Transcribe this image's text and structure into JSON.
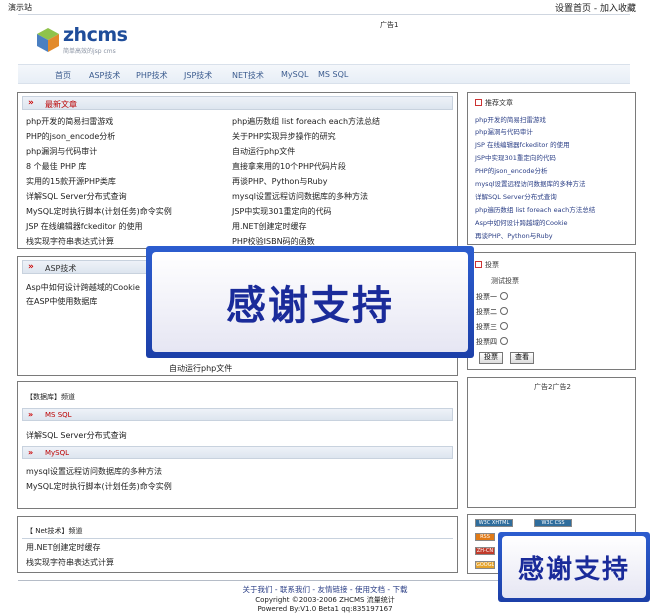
{
  "topbar": {
    "site_name": "演示站",
    "set_home": "设置首页",
    "sep": " - ",
    "add_fav": "加入收藏"
  },
  "logo": {
    "name": "zhcms",
    "slogan": "简单高效的jsp cms"
  },
  "ad1": "广告1",
  "nav": [
    "首页",
    "ASP技术",
    "PHP技术",
    "JSP技术",
    "NET技术",
    "MySQL",
    "MS SQL"
  ],
  "latest": {
    "title": "最新文章",
    "left": [
      "php开发的简易扫雷游戏",
      "PHP的json_encode分析",
      "php漏洞与代码审计",
      "8 个最佳 PHP 库",
      "实用的15款开源PHP类库",
      "详解SQL Server分布式查询",
      "MySQL定时执行脚本(计划任务)命令实例",
      "JSP 在线编辑器fckeditor 的使用",
      "栈实现字符串表达式计算"
    ],
    "right": [
      "php遍历数组 list foreach each方法总结",
      "关于PHP实现异步操作的研究",
      "自动运行php文件",
      "直接拿来用的10个PHP代码片段",
      "再谈PHP、Python与Ruby",
      "mysql设置远程访问数据库的多种方法",
      "JSP中实现301重定向的代码",
      "用.NET创建定时缓存",
      "PHP校验ISBN码的函数"
    ]
  },
  "asp": {
    "title": "ASP技术",
    "items": [
      "Asp中如何设计跨越域的Cookie",
      "在ASP中使用数据库"
    ],
    "extra": "自动运行php文件"
  },
  "db": {
    "title": "【数据库】频道",
    "mssql": {
      "title": "MS SQL",
      "items": [
        "详解SQL Server分布式查询"
      ]
    },
    "mysql": {
      "title": "MySQL",
      "items": [
        "mysql设置远程访问数据库的多种方法",
        "MySQL定时执行脚本(计划任务)命令实例"
      ]
    }
  },
  "net": {
    "title": "【 Net技术】频道",
    "items": [
      "用.NET创建定时缓存",
      "栈实现字符串表达式计算"
    ]
  },
  "recommend": {
    "title": "推荐文章",
    "items": [
      "php开发的简易扫雷游戏",
      "php漏洞与代码审计",
      "JSP 在线编辑器fckeditor 的使用",
      "JSP中实现301重定向的代码",
      "PHP的json_encode分析",
      "mysql设置远程访问数据库的多种方法",
      "详解SQL Server分布式查询",
      "php遍历数组 list foreach each方法总结",
      "Asp中如何设计跨越域的Cookie",
      "再谈PHP、Python与Ruby"
    ]
  },
  "poll": {
    "title": "投票",
    "subject": "测试投票",
    "options": [
      "投票一",
      "投票二",
      "投票三",
      "投票四"
    ],
    "vote_btn": "投票",
    "view_btn": "查看"
  },
  "ad2": "广告2广告2",
  "badges": [
    "W3C XHTML",
    "W3C CSS",
    "RSS",
    "ZH-CN",
    "GOOGLE"
  ],
  "footer": {
    "links": "关于我们 - 联系我们 - 友情链接 - 使用文档 - 下载",
    "copyright": "Copyright ©2003-2006 ZHCMS 流量统计",
    "powered": "Powered By:V1.0 Beta1 qq:835197167"
  },
  "watermark": "感谢支持",
  "colors": {
    "nav_text": "#3b5b8e",
    "title_red": "#b00",
    "link_blue": "#2b3f86",
    "overlay_blue": "#1c3fa8"
  }
}
